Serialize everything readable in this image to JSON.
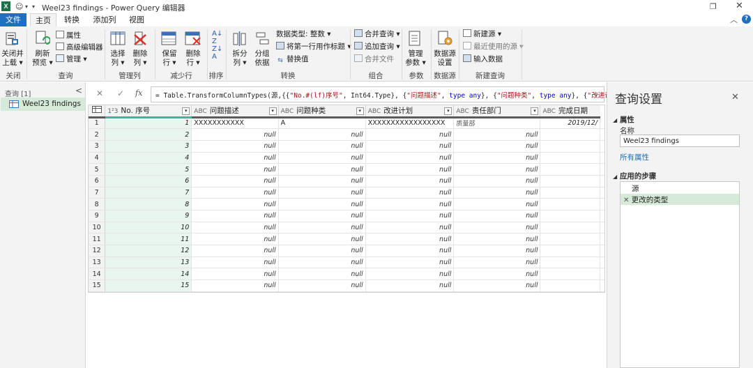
{
  "window": {
    "title": "Weel23 findings - Power Query 编辑器",
    "restore_icon": "restore-icon",
    "close_icon": "close-icon"
  },
  "tabs": [
    {
      "label": "文件"
    },
    {
      "label": "主页"
    },
    {
      "label": "转换"
    },
    {
      "label": "添加列"
    },
    {
      "label": "视图"
    }
  ],
  "ribbon": {
    "close_load": "关闭并\n上载",
    "close_load_l1": "关闭并",
    "close_load_l2": "上载 ▾",
    "refresh_l1": "刷新",
    "refresh_l2": "预览 ▾",
    "properties": "属性",
    "advanced_editor": "高级编辑器",
    "manage": "管理 ▾",
    "choose_cols_l1": "选择",
    "choose_cols_l2": "列 ▾",
    "remove_cols_l1": "删除",
    "remove_cols_l2": "列 ▾",
    "keep_rows_l1": "保留",
    "keep_rows_l2": "行 ▾",
    "remove_rows_l1": "删除",
    "remove_rows_l2": "行 ▾",
    "split_l1": "拆分",
    "split_l2": "列 ▾",
    "group_l1": "分组",
    "group_l2": "依据",
    "data_type": "数据类型: 整数 ▾",
    "first_row_header": "将第一行用作标题 ▾",
    "replace_values": "替换值",
    "merge_queries": "合并查询 ▾",
    "append_queries": "追加查询 ▾",
    "combine_files": "合并文件",
    "manage_params_l1": "管理",
    "manage_params_l2": "参数 ▾",
    "datasource_l1": "数据源",
    "datasource_l2": "设置",
    "new_source": "新建源 ▾",
    "recent_sources": "最近使用的源 ▾",
    "enter_data": "输入数据",
    "groups": {
      "close": "关闭",
      "query": "查询",
      "manage_cols": "管理列",
      "reduce_rows": "减少行",
      "sort": "排序",
      "transform": "转换",
      "combine": "组合",
      "params": "参数",
      "datasource": "数据源",
      "new_query": "新建查询"
    }
  },
  "left_pane": {
    "header": "查询 [1]",
    "collapse": "<",
    "query_name": "Weel23 findings"
  },
  "formula_bar": {
    "cancel": "✕",
    "confirm": "✓",
    "fx": "fx",
    "formula_prefix": "= Table.TransformColumnTypes(源,{{",
    "seg1": "\"No.#(lf)序号\"",
    "seg2": ", Int64.Type}, {",
    "seg3": "\"问题描述\"",
    "seg4": ", ",
    "seg5": "type any",
    "seg6": "}, {",
    "seg7": "\"问题种类\"",
    "seg8": ", ",
    "seg9": "type any",
    "seg10": "}, {",
    "seg11": "\"改进计",
    "expand": "⌄"
  },
  "grid": {
    "columns": [
      {
        "type_icon": "1²3",
        "name": "No. 序号"
      },
      {
        "type_icon": "ABC\n123",
        "name": "问题描述"
      },
      {
        "type_icon": "ABC\n123",
        "name": "问题种类"
      },
      {
        "type_icon": "ABC\n123",
        "name": "改进计划"
      },
      {
        "type_icon": "ABC\n123",
        "name": "责任部门"
      },
      {
        "type_icon": "ABC\n123",
        "name": "完成日期"
      }
    ],
    "rows": [
      {
        "n": "1",
        "cells": [
          "1",
          "XXXXXXXXXXX",
          "A",
          "XXXXXXXXXXXXXXXXX",
          "质量部",
          "2019/12/"
        ]
      },
      {
        "n": "2",
        "cells": [
          "2",
          "null",
          "null",
          "null",
          "null",
          ""
        ]
      },
      {
        "n": "3",
        "cells": [
          "3",
          "null",
          "null",
          "null",
          "null",
          ""
        ]
      },
      {
        "n": "4",
        "cells": [
          "4",
          "null",
          "null",
          "null",
          "null",
          ""
        ]
      },
      {
        "n": "5",
        "cells": [
          "5",
          "null",
          "null",
          "null",
          "null",
          ""
        ]
      },
      {
        "n": "6",
        "cells": [
          "6",
          "null",
          "null",
          "null",
          "null",
          ""
        ]
      },
      {
        "n": "7",
        "cells": [
          "7",
          "null",
          "null",
          "null",
          "null",
          ""
        ]
      },
      {
        "n": "8",
        "cells": [
          "8",
          "null",
          "null",
          "null",
          "null",
          ""
        ]
      },
      {
        "n": "9",
        "cells": [
          "9",
          "null",
          "null",
          "null",
          "null",
          ""
        ]
      },
      {
        "n": "10",
        "cells": [
          "10",
          "null",
          "null",
          "null",
          "null",
          ""
        ]
      },
      {
        "n": "11",
        "cells": [
          "11",
          "null",
          "null",
          "null",
          "null",
          ""
        ]
      },
      {
        "n": "12",
        "cells": [
          "12",
          "null",
          "null",
          "null",
          "null",
          ""
        ]
      },
      {
        "n": "13",
        "cells": [
          "13",
          "null",
          "null",
          "null",
          "null",
          ""
        ]
      },
      {
        "n": "14",
        "cells": [
          "14",
          "null",
          "null",
          "null",
          "null",
          ""
        ]
      },
      {
        "n": "15",
        "cells": [
          "15",
          "null",
          "null",
          "null",
          "null",
          ""
        ]
      }
    ]
  },
  "right_pane": {
    "title": "查询设置",
    "close": "✕",
    "properties_header": "属性",
    "name_label": "名称",
    "name_value": "Weel23 findings",
    "all_properties": "所有属性",
    "steps_header": "应用的步骤",
    "steps": [
      {
        "label": "源",
        "deletable": false
      },
      {
        "label": "更改的类型",
        "deletable": true
      }
    ]
  },
  "colors": {
    "file_tab": "#1e6fbf",
    "accent_green": "#39b89a",
    "selected_step": "#d5ead8",
    "selected_col": "#e9f5ef"
  }
}
